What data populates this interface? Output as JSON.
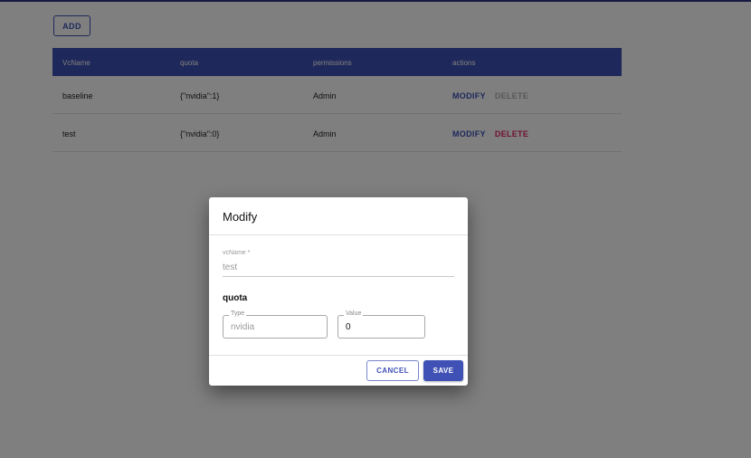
{
  "toolbar": {
    "add_label": "ADD"
  },
  "table": {
    "columns": [
      "VcName",
      "quota",
      "permissions",
      "actions"
    ],
    "rows": [
      {
        "vcname": "baseline",
        "quota": "{\"nvidia\":1}",
        "permissions": "Admin",
        "modify_label": "MODIFY",
        "delete_label": "DELETE",
        "delete_enabled": false
      },
      {
        "vcname": "test",
        "quota": "{\"nvidia\":0}",
        "permissions": "Admin",
        "modify_label": "MODIFY",
        "delete_label": "DELETE",
        "delete_enabled": true
      }
    ]
  },
  "dialog": {
    "title": "Modify",
    "vcname_label": "vcName *",
    "vcname_value": "test",
    "quota_title": "quota",
    "type_label": "Type",
    "type_value": "nvidia",
    "value_label": "Value",
    "value_value": "0",
    "cancel_label": "CANCEL",
    "save_label": "SAVE"
  },
  "colors": {
    "primary": "#3f51b5",
    "delete": "#e0245e",
    "disabled": "#b0b0b0"
  }
}
